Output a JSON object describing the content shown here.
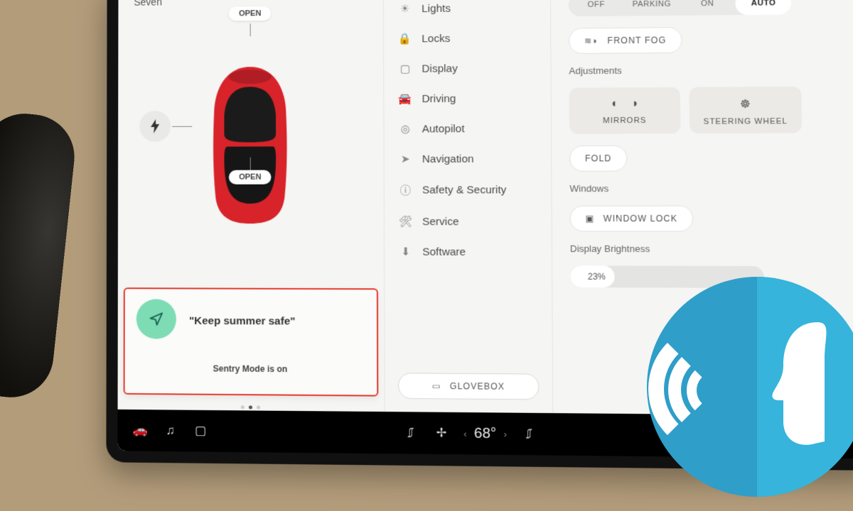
{
  "profile": {
    "name": "Seven"
  },
  "car": {
    "open_label": "OPEN"
  },
  "voice_card": {
    "query": "\"Keep summer safe\"",
    "status": "Sentry Mode is on"
  },
  "menu": {
    "items": [
      {
        "icon": "light-icon",
        "label": "Lights"
      },
      {
        "icon": "lock-icon",
        "label": "Locks"
      },
      {
        "icon": "display-icon",
        "label": "Display"
      },
      {
        "icon": "driving-icon",
        "label": "Driving"
      },
      {
        "icon": "autopilot-icon",
        "label": "Autopilot"
      },
      {
        "icon": "nav-icon",
        "label": "Navigation"
      },
      {
        "icon": "safety-icon",
        "label": "Safety & Security"
      },
      {
        "icon": "service-icon",
        "label": "Service"
      },
      {
        "icon": "software-icon",
        "label": "Software"
      }
    ],
    "glovebox": "GLOVEBOX"
  },
  "right": {
    "light_modes": {
      "options": [
        "OFF",
        "PARKING",
        "ON",
        "AUTO"
      ],
      "active": "AUTO"
    },
    "front_fog": "FRONT FOG",
    "adjustments_label": "Adjustments",
    "mirrors": "MIRRORS",
    "steering": "STEERING WHEEL",
    "fold": "FOLD",
    "windows_label": "Windows",
    "window_lock": "WINDOW LOCK",
    "brightness_label": "Display Brightness",
    "brightness_value": "23%"
  },
  "dock": {
    "temp": "68°"
  }
}
